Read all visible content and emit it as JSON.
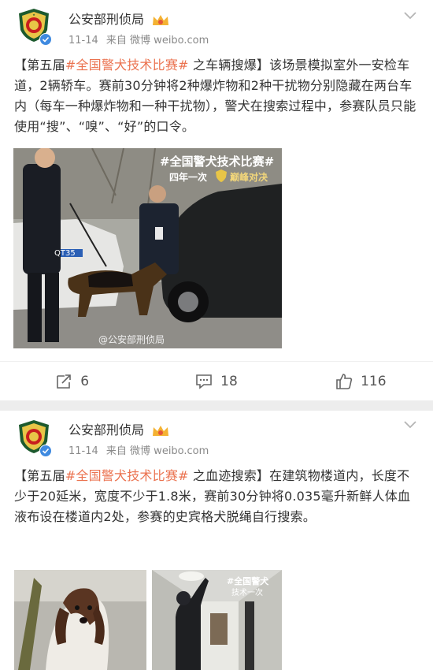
{
  "posts": [
    {
      "author": "公安部刑侦局",
      "date": "11-14",
      "source": "来自 微博 weibo.com",
      "text_parts": [
        "【第五届",
        "#全国警犬技术比赛#",
        " 之车辆搜爆】该场景模拟室外一安检车道，2辆轿车。赛前30分钟将2种爆炸物和2种干扰物分别隐藏在两台车内（每车一种爆炸物和一种干扰物），警犬在搜索过程中，参赛队员只能使用“搜”、“嗅”、“好”的口令。"
      ],
      "image_overlay": {
        "hashtag": "#全国警犬技术比赛#",
        "line2_left": "四年一次",
        "line2_right": "巅峰对决",
        "watermark": "@公安部刑侦局",
        "plate": "QT35"
      },
      "actions": {
        "repost_count": "6",
        "comment_count": "18",
        "like_count": "116"
      }
    },
    {
      "author": "公安部刑侦局",
      "date": "11-14",
      "source": "来自 微博 weibo.com",
      "text_parts": [
        "【第五届",
        "#全国警犬技术比赛#",
        " 之血迹搜索】在建筑物楼道内，长度不少于20延米，宽度不少于1.8米，赛前30分钟将0.035毫升新鲜人体血液布设在楼道内2处，参赛的史宾格犬脱绳自行搜索。"
      ],
      "image_overlay": {
        "hashtag": "#全国警犬",
        "line2": "技术一次"
      }
    }
  ],
  "colors": {
    "hashtag": "#eb7350",
    "meta": "#8a8a8a",
    "text": "#333333"
  }
}
